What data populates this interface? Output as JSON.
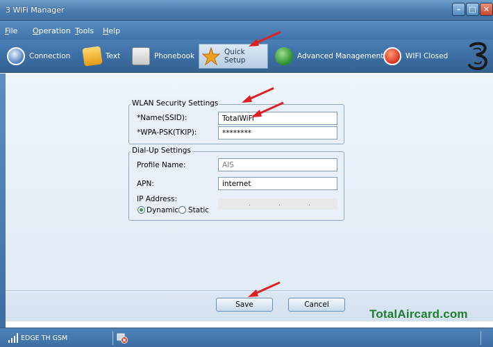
{
  "window": {
    "title": "3 WiFi Manager"
  },
  "menu": [
    {
      "label": "File",
      "key": "F",
      "rest": "ile"
    },
    {
      "label": "Operation",
      "key": "O",
      "rest": "peration"
    },
    {
      "label": "Tools",
      "key": "T",
      "rest": "ools"
    },
    {
      "label": "Help",
      "key": "H",
      "rest": "elp"
    }
  ],
  "toolbar": {
    "items": [
      {
        "label": "Connection",
        "icon": "connection-icon"
      },
      {
        "label": "Text",
        "icon": "envelope-icon"
      },
      {
        "label": "Phonebook",
        "icon": "phonebook-icon"
      },
      {
        "label": "Quick Setup",
        "icon": "star-icon",
        "active": true
      },
      {
        "label": "Advanced Management",
        "icon": "globe-star-icon"
      },
      {
        "label": "WIFI Closed",
        "icon": "power-icon"
      }
    ],
    "brand_logo": "3"
  },
  "wlan": {
    "legend": "WLAN Security Settings",
    "ssid_label": "*Name(SSID):",
    "ssid_value": "TotalWiFi",
    "psk_label": "*WPA-PSK(TKIP):",
    "psk_value": "********"
  },
  "dialup": {
    "legend": "Dial-Up Settings",
    "profile_label": "Profile Name:",
    "profile_value": "AIS",
    "apn_label": "APN:",
    "apn_value": "internet",
    "ip_label": "IP Address:",
    "ip_dots": [
      ".",
      ".",
      "."
    ],
    "mode_dynamic": "Dynamic",
    "mode_static": "Static",
    "selected_mode": "Dynamic"
  },
  "buttons": {
    "save": "Save",
    "cancel": "Cancel"
  },
  "watermark": "TotalAircard.com",
  "status": {
    "signal_text": "EDGE  TH GSM"
  },
  "colors": {
    "titlebar": "#4b7db0",
    "toolbar": "#3a6ca1",
    "watermark": "#1f7d2e",
    "arrow": "#e02020"
  }
}
